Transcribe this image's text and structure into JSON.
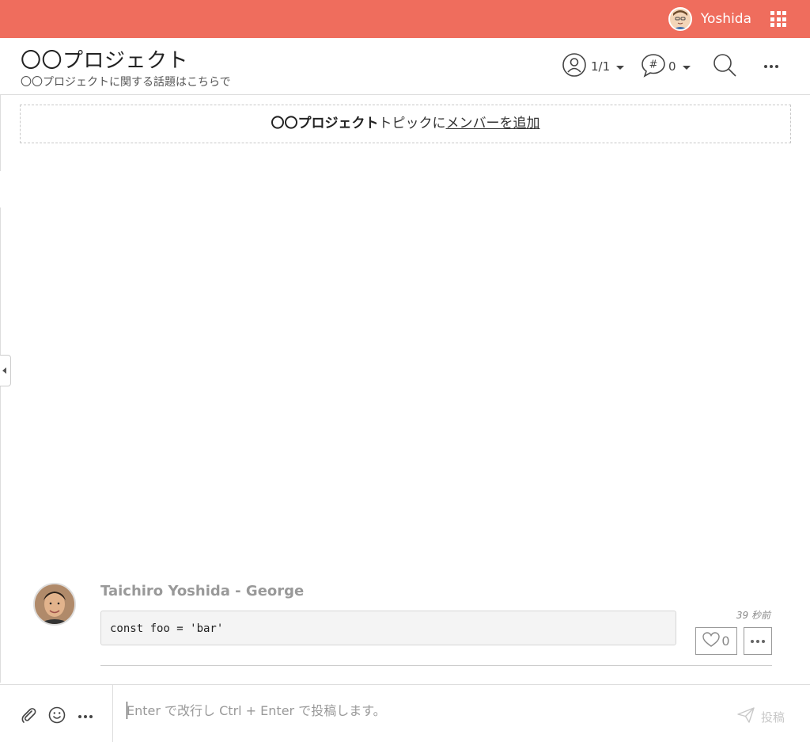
{
  "topbar": {
    "user_name": "Yoshida",
    "background_color": "#ef6d5d",
    "avatar_icon": "user-avatar-icon",
    "apps_icon": "apps-grid-icon"
  },
  "header": {
    "title": "〇〇プロジェクト",
    "subtitle": "〇〇プロジェクトに関する話題はこちらで",
    "members_count": "1/1",
    "hashtags_count": "0"
  },
  "add_member": {
    "topic_name": "〇〇プロジェクト",
    "middle_text": "トピックに",
    "link_text": "メンバーを追加"
  },
  "message": {
    "author": "Taichiro Yoshida - George",
    "code": "const foo = 'bar'",
    "time": "39 秒前",
    "like_count": "0"
  },
  "composer": {
    "placeholder": "Enter で改行し Ctrl + Enter で投稿します。",
    "value": "",
    "send_label": "投稿"
  }
}
